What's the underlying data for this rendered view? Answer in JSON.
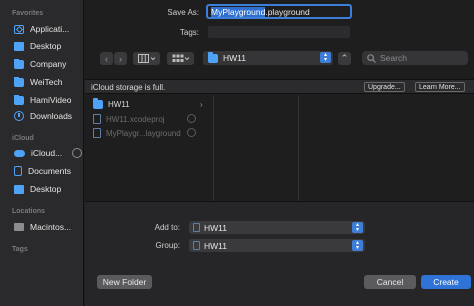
{
  "sidebar": {
    "favorites_label": "Favorites",
    "favorites": [
      {
        "label": "Applicati...",
        "icon": "applications-icon"
      },
      {
        "label": "Desktop",
        "icon": "desktop-icon"
      },
      {
        "label": "Company",
        "icon": "folder-icon"
      },
      {
        "label": "WeiTech",
        "icon": "folder-icon"
      },
      {
        "label": "HamiVideo",
        "icon": "folder-icon"
      },
      {
        "label": "Downloads",
        "icon": "downloads-icon"
      }
    ],
    "icloud_label": "iCloud",
    "icloud": [
      {
        "label": "iCloud...",
        "icon": "icloud-icon"
      },
      {
        "label": "Documents",
        "icon": "document-icon"
      },
      {
        "label": "Desktop",
        "icon": "desktop-icon"
      }
    ],
    "locations_label": "Locations",
    "locations": [
      {
        "label": "Macintos...",
        "icon": "disk-icon"
      }
    ],
    "tags_label": "Tags"
  },
  "form": {
    "save_as_label": "Save As:",
    "save_as_selected": "MyPlayground",
    "save_as_extension": ".playground",
    "tags_label": "Tags:",
    "tags_value": ""
  },
  "toolbar": {
    "back": "‹",
    "forward": "›",
    "location": "HW11",
    "expand": "⌃",
    "search_placeholder": "Search"
  },
  "icloud_bar": {
    "message": "iCloud storage is full.",
    "upgrade_label": "Upgrade...",
    "learn_more_label": "Learn More..."
  },
  "browser": {
    "items": [
      {
        "name": "HW11",
        "type": "folder",
        "dim": false
      },
      {
        "name": "HW11.xcodeproj",
        "type": "file",
        "dim": true
      },
      {
        "name": "MyPlaygr...layground",
        "type": "file",
        "dim": true
      }
    ]
  },
  "footer": {
    "add_to_label": "Add to:",
    "add_to_value": "HW11",
    "group_label": "Group:",
    "group_value": "HW11",
    "new_folder_label": "New Folder",
    "cancel_label": "Cancel",
    "create_label": "Create"
  },
  "colors": {
    "accent": "#2f73d6",
    "folder": "#4fa3f7",
    "background": "#1e1e1e",
    "sidebar": "#2a2a2c"
  }
}
